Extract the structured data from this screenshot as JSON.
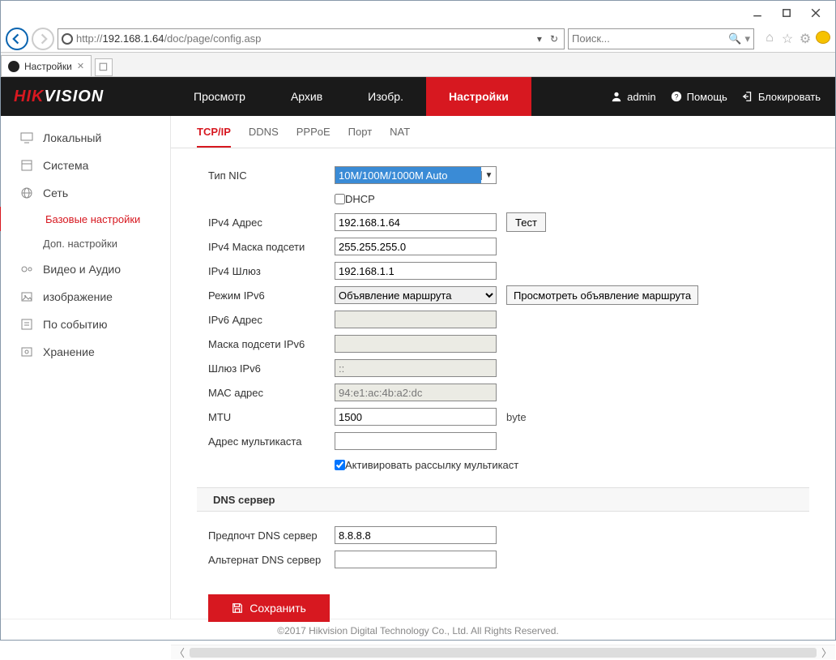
{
  "browser": {
    "url_prefix": "http://",
    "url_host": "192.168.1.64",
    "url_path": "/doc/page/config.asp",
    "search_placeholder": "Поиск...",
    "tab_title": "Настройки"
  },
  "header": {
    "logo_hik": "HIK",
    "logo_vision": "VISION",
    "nav": [
      "Просмотр",
      "Архив",
      "Изобр.",
      "Настройки"
    ],
    "nav_active_index": 3,
    "user": "admin",
    "help": "Помощь",
    "logout": "Блокировать"
  },
  "sidebar": {
    "items": [
      {
        "label": "Локальный"
      },
      {
        "label": "Система"
      },
      {
        "label": "Сеть",
        "children": [
          {
            "label": "Базовые настройки",
            "active": true
          },
          {
            "label": "Доп. настройки"
          }
        ]
      },
      {
        "label": "Видео и Аудио"
      },
      {
        "label": "изображение"
      },
      {
        "label": "По событию"
      },
      {
        "label": "Хранение"
      }
    ]
  },
  "subtabs": {
    "items": [
      "TCP/IP",
      "DDNS",
      "PPPoE",
      "Порт",
      "NAT"
    ],
    "active_index": 0
  },
  "form": {
    "nic_type_label": "Тип NIC",
    "nic_type_value": "10M/100M/1000M Auto",
    "dhcp_label": "DHCP",
    "dhcp_checked": false,
    "ipv4_addr_label": "IPv4 Адрес",
    "ipv4_addr_value": "192.168.1.64",
    "test_btn": "Тест",
    "ipv4_mask_label": "IPv4 Маска подсети",
    "ipv4_mask_value": "255.255.255.0",
    "ipv4_gw_label": "IPv4 Шлюз",
    "ipv4_gw_value": "192.168.1.1",
    "ipv6_mode_label": "Режим IPv6",
    "ipv6_mode_value": "Объявление маршрута",
    "ipv6_route_btn": "Просмотреть объявление маршрута",
    "ipv6_addr_label": "IPv6 Адрес",
    "ipv6_addr_value": "",
    "ipv6_mask_label": "Маска подсети IPv6",
    "ipv6_mask_value": "",
    "ipv6_gw_label": "Шлюз IPv6",
    "ipv6_gw_value": "::",
    "mac_label": "МАС адрес",
    "mac_value": "94:e1:ac:4b:a2:dc",
    "mtu_label": "MTU",
    "mtu_value": "1500",
    "mtu_unit": "byte",
    "multicast_addr_label": "Адрес мультикаста",
    "multicast_addr_value": "",
    "multicast_enable_label": "Активировать рассылку мультикаст",
    "multicast_enable_checked": true,
    "dns_section": "DNS сервер",
    "dns_pref_label": "Предпочт DNS сервер",
    "dns_pref_value": "8.8.8.8",
    "dns_alt_label": "Альтернат DNS сервер",
    "dns_alt_value": "",
    "save_btn": "Сохранить"
  },
  "footer": "©2017 Hikvision Digital Technology Co., Ltd. All Rights Reserved."
}
